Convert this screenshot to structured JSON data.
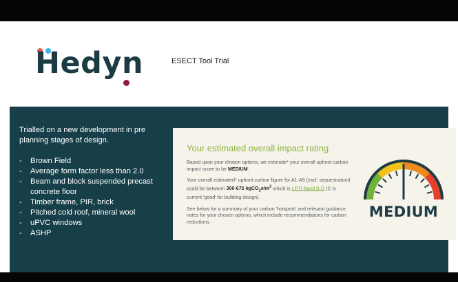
{
  "logo": {
    "text": "Hedyn"
  },
  "header": {
    "title": "ESECT Tool Trial"
  },
  "trial": {
    "intro": "Trialled on a new development in pre planning stages of design.",
    "items": [
      "Brown Field",
      "Average form factor less than 2.0",
      "Beam and block suspended precast concrete floor",
      "Timber frame, PIR, brick",
      "Pitched cold roof, mineral wool",
      "uPVC windows",
      "ASHP"
    ]
  },
  "impact": {
    "title": "Your estimated overall impact rating",
    "para1_pre": "Based upon your chosen options, we estimate* your overall upfront carbon impact score to be ",
    "para1_bold": "MEDIUM",
    "para1_post": ".",
    "para2_pre": "Your overall estimated* upfront carbon figure for A1-A5 (excl. sequestration) could be between ",
    "para2_bold": "300-675 kgCO",
    "para2_sub": "2",
    "para2_unit": "e/m",
    "para2_sup": "2",
    "para2_mid": " which is ",
    "para2_link": "LETI Band B-D",
    "para2_post": " (C is current 'good' for building design).",
    "para3": "See below for a summary of your carbon 'hotspots' and relevant guidance notes for your chosen options, which include recommendations for carbon reductions.",
    "rating_label": "MEDIUM",
    "gauge_level": 0.5
  },
  "colors": {
    "panel": "#173f4a",
    "card": "#f6f3ea",
    "accent_green": "#8ab43c",
    "gauge_green": "#6fb33a",
    "gauge_yellow": "#f2c21b",
    "gauge_orange": "#ef8a1e",
    "gauge_red": "#e5402a"
  }
}
